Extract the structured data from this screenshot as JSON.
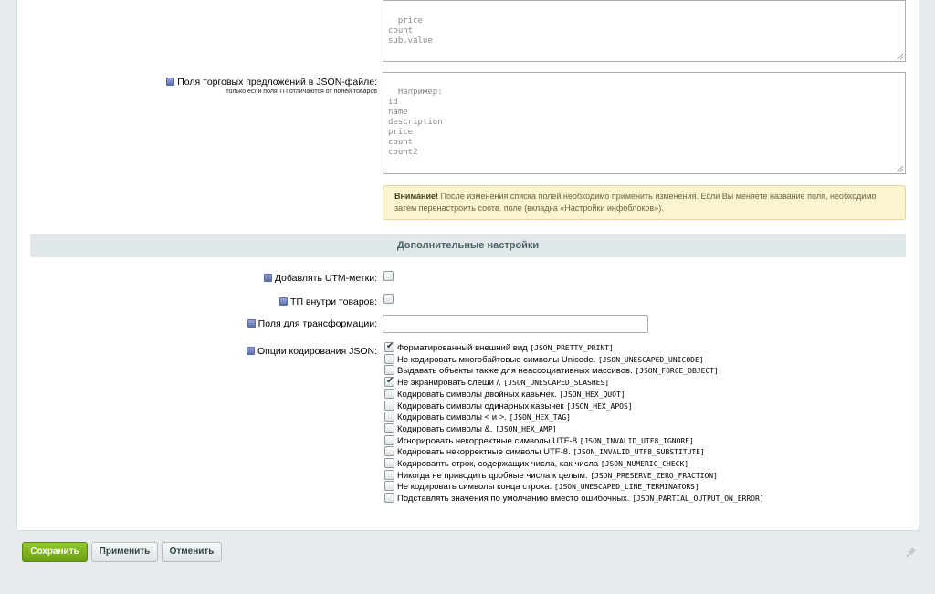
{
  "top_textarea": {
    "lines": "price\ncount\nsub.value"
  },
  "offers_field": {
    "label": "Поля торговых предложений в JSON-файле:",
    "sublabel": "только если поля ТП отличаются от полей товаров",
    "value": "Например:\nid\nname\ndescription\nprice\ncount\ncount2"
  },
  "warning": {
    "bold": "Внимание!",
    "text": " После изменения списка полей необходимо применить изменения. Если Вы меняете название поля, необходимо затем перенастроить соотв. поле (вкладка «Настройки инфоблоков»)."
  },
  "section_title": "Дополнительные настройки",
  "settings": {
    "utm_label": "Добавлять UTM-метки:",
    "utm_checked": false,
    "tp_label": "ТП внутри товаров:",
    "tp_checked": false,
    "transform_label": "Поля для трансформации:",
    "transform_value": "",
    "json_label": "Опции кодирования JSON:"
  },
  "json_options": [
    {
      "text": "Форматированный внешний вид",
      "code": "[JSON_PRETTY_PRINT]",
      "checked": true
    },
    {
      "text": "Не кодировать многобайтовые символы Unicode.",
      "code": "[JSON_UNESCAPED_UNICODE]",
      "checked": false
    },
    {
      "text": "Выдавать объекты также для неассоциативных массивов.",
      "code": "[JSON_FORCE_OBJECT]",
      "checked": false
    },
    {
      "text": "Не экранировать слеши /.",
      "code": "[JSON_UNESCAPED_SLASHES]",
      "checked": true
    },
    {
      "text": "Кодировать символы двойных кавычек.",
      "code": "[JSON_HEX_QUOT]",
      "checked": false
    },
    {
      "text": "Кодировать символы одинарных кавычек",
      "code": "[JSON_HEX_APOS]",
      "checked": false
    },
    {
      "text": "Кодировать символы < и >.",
      "code": "[JSON_HEX_TAG]",
      "checked": false
    },
    {
      "text": "Кодировать символы &.",
      "code": "[JSON_HEX_AMP]",
      "checked": false
    },
    {
      "text": "Игнорировать некорректные символы UTF-8",
      "code": "[JSON_INVALID_UTF8_IGNORE]",
      "checked": false
    },
    {
      "text": "Кодировать некорректные символы UTF-8.",
      "code": "[JSON_INVALID_UTF8_SUBSTITUTE]",
      "checked": false
    },
    {
      "text": "Кодироваnть строк, содержащих числа, как числа",
      "code": "[JSON_NUMERIC_CHECK]",
      "checked": false
    },
    {
      "text": "Никогда не приводить дробные числа к целым.",
      "code": "[JSON_PRESERVE_ZERO_FRACTION]",
      "checked": false
    },
    {
      "text": "Не кодировать символы конца строка.",
      "code": "[JSON_UNESCAPED_LINE_TERMINATORS]",
      "checked": false
    },
    {
      "text": "Подставлять значения по умолчанию вместо ошибочных.",
      "code": "[JSON_PARTIAL_OUTPUT_ON_ERROR]",
      "checked": false
    }
  ],
  "buttons": {
    "save": "Сохранить",
    "apply": "Применить",
    "cancel": "Отменить"
  },
  "colors": {
    "save_button": "#7cb31b",
    "section_bg": "#e0e8ea",
    "warning_bg": "#fbf4cf"
  },
  "icons": {
    "hint": "question-icon",
    "pin": "pin-icon"
  }
}
